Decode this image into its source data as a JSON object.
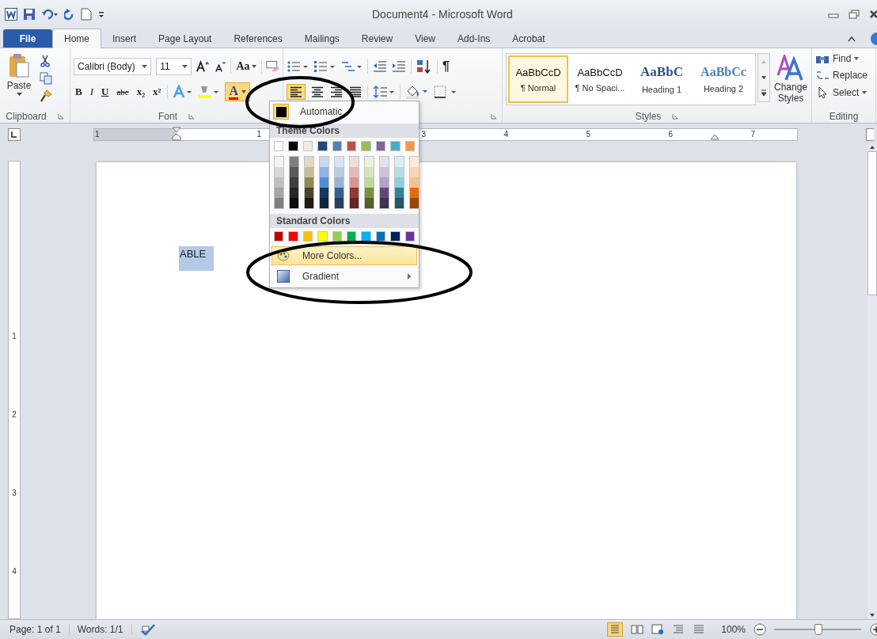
{
  "window": {
    "title": "Document4 - Microsoft Word"
  },
  "tabs": [
    {
      "label": "File",
      "kind": "file",
      "selected": false
    },
    {
      "label": "Home",
      "kind": "tab",
      "selected": true
    },
    {
      "label": "Insert",
      "kind": "tab",
      "selected": false
    },
    {
      "label": "Page Layout",
      "kind": "tab",
      "selected": false
    },
    {
      "label": "References",
      "kind": "tab",
      "selected": false
    },
    {
      "label": "Mailings",
      "kind": "tab",
      "selected": false
    },
    {
      "label": "Review",
      "kind": "tab",
      "selected": false
    },
    {
      "label": "View",
      "kind": "tab",
      "selected": false
    },
    {
      "label": "Add-Ins",
      "kind": "tab",
      "selected": false
    },
    {
      "label": "Acrobat",
      "kind": "tab",
      "selected": false
    }
  ],
  "clipboard": {
    "paste": "Paste",
    "group": "Clipboard"
  },
  "font": {
    "name": "Calibri (Body)",
    "size": "11",
    "change_case": "Aa",
    "buttons": [
      "B",
      "I",
      "U",
      "abc",
      "x₂",
      "x²"
    ],
    "color_button": "A",
    "group": "Font"
  },
  "paragraph": {
    "pilcrow": "¶",
    "align_left_selected": true
  },
  "styles": {
    "items": [
      {
        "preview": "AaBbCcD",
        "name": "¶ Normal",
        "kind": "body",
        "selected": true
      },
      {
        "preview": "AaBbCcD",
        "name": "¶ No Spaci...",
        "kind": "body",
        "selected": false
      },
      {
        "preview": "AaBbC",
        "name": "Heading 1",
        "kind": "heading1",
        "selected": false
      },
      {
        "preview": "AaBbCc",
        "name": "Heading 2",
        "kind": "heading2",
        "selected": false
      }
    ],
    "change": "Change Styles",
    "group": "Styles"
  },
  "editing": {
    "items": [
      "Find",
      "Replace",
      "Select"
    ],
    "group": "Editing"
  },
  "ruler": {
    "marks": [
      "1",
      "1",
      "3",
      "4",
      "5",
      "6",
      "7"
    ],
    "vertical_marks": [
      "1",
      "2",
      "3",
      "4"
    ]
  },
  "document": {
    "text": "ABLE",
    "selected": true
  },
  "color_menu": {
    "automatic": "Automatic",
    "theme_heading": "Theme Colors",
    "theme_colors": [
      {
        "color": "#ffffff",
        "shades": [
          {
            "color": "#f2f2f2"
          },
          {
            "color": "#d8d8d8"
          },
          {
            "color": "#bfbfbf"
          },
          {
            "color": "#a5a5a5"
          },
          {
            "color": "#7f7f7f"
          }
        ]
      },
      {
        "color": "#000000",
        "shades": [
          {
            "color": "#7f7f7f"
          },
          {
            "color": "#595959"
          },
          {
            "color": "#3f3f3f"
          },
          {
            "color": "#262626"
          },
          {
            "color": "#0c0c0c"
          }
        ]
      },
      {
        "color": "#eeece1",
        "shades": [
          {
            "color": "#ddd9c3"
          },
          {
            "color": "#c4bd97"
          },
          {
            "color": "#938953"
          },
          {
            "color": "#494429"
          },
          {
            "color": "#1d1b10"
          }
        ]
      },
      {
        "color": "#1f497d",
        "shades": [
          {
            "color": "#c6d9f0"
          },
          {
            "color": "#8db3e2"
          },
          {
            "color": "#548dd4"
          },
          {
            "color": "#17365d"
          },
          {
            "color": "#0f243e"
          }
        ]
      },
      {
        "color": "#4f81bd",
        "shades": [
          {
            "color": "#dbe5f1"
          },
          {
            "color": "#b8cce4"
          },
          {
            "color": "#95b3d7"
          },
          {
            "color": "#366092"
          },
          {
            "color": "#244061"
          }
        ]
      },
      {
        "color": "#c0504d",
        "shades": [
          {
            "color": "#f2dcdb"
          },
          {
            "color": "#e5b9b7"
          },
          {
            "color": "#d99694"
          },
          {
            "color": "#953734"
          },
          {
            "color": "#632423"
          }
        ]
      },
      {
        "color": "#9bbb59",
        "shades": [
          {
            "color": "#ebf1dd"
          },
          {
            "color": "#d7e3bc"
          },
          {
            "color": "#c3d69b"
          },
          {
            "color": "#76923c"
          },
          {
            "color": "#4f6128"
          }
        ]
      },
      {
        "color": "#8064a2",
        "shades": [
          {
            "color": "#e5e0ec"
          },
          {
            "color": "#ccc1d9"
          },
          {
            "color": "#b2a2c7"
          },
          {
            "color": "#5f497a"
          },
          {
            "color": "#3f3151"
          }
        ]
      },
      {
        "color": "#4bacc6",
        "shades": [
          {
            "color": "#dbeef3"
          },
          {
            "color": "#b7dde8"
          },
          {
            "color": "#92cddc"
          },
          {
            "color": "#31859b"
          },
          {
            "color": "#205867"
          }
        ]
      },
      {
        "color": "#f79646",
        "shades": [
          {
            "color": "#fdeada"
          },
          {
            "color": "#fbd5b5"
          },
          {
            "color": "#fac08f"
          },
          {
            "color": "#e36c09"
          },
          {
            "color": "#974806"
          }
        ]
      }
    ],
    "standard_heading": "Standard Colors",
    "standard_colors": [
      {
        "color": "#c00000"
      },
      {
        "color": "#ff0000"
      },
      {
        "color": "#ffc000"
      },
      {
        "color": "#ffff00"
      },
      {
        "color": "#92d050"
      },
      {
        "color": "#00b050"
      },
      {
        "color": "#00b0f0"
      },
      {
        "color": "#0070c0"
      },
      {
        "color": "#002060"
      },
      {
        "color": "#7030a0"
      }
    ],
    "items": [
      {
        "label": "More Colors...",
        "kind": "palette",
        "selected": true,
        "submenu": false
      },
      {
        "label": "Gradient",
        "kind": "gradient",
        "selected": false,
        "submenu": true
      }
    ]
  },
  "status_bar": {
    "page": "Page: 1 of 1",
    "words": "Words: 1/1",
    "zoom": "100%",
    "zoom_slider": {
      "level": 0.5
    }
  }
}
